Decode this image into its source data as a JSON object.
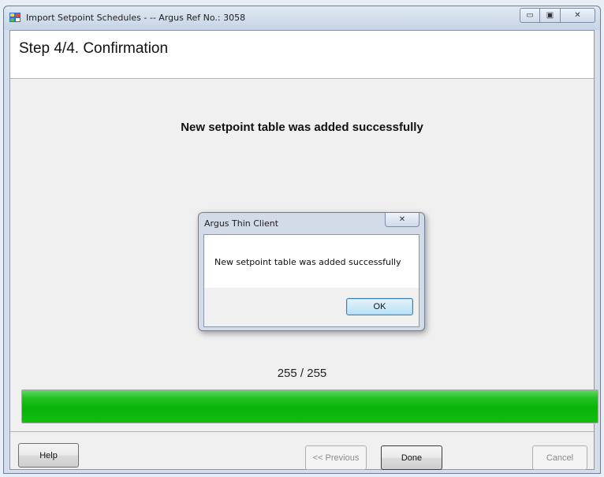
{
  "window": {
    "title": "Import Setpoint Schedules - -- Argus Ref No.: 3058",
    "minimize_glyph": "▭",
    "maximize_glyph": "▣",
    "close_glyph": "✕"
  },
  "step": {
    "title": "Step 4/4. Confirmation"
  },
  "main": {
    "message": "New setpoint table was added successfully"
  },
  "dialog": {
    "title": "Argus Thin Client",
    "close_glyph": "✕",
    "message": "New setpoint table was added successfully",
    "ok_label": "OK"
  },
  "progress": {
    "counter_text": "255 / 255",
    "fraction": 1.0,
    "color": "#08b408"
  },
  "footer": {
    "help_label": "Help",
    "previous_label": "<< Previous",
    "done_label": "Done",
    "cancel_label": "Cancel"
  },
  "icons": [
    "app-icon",
    "minimize-icon",
    "maximize-icon",
    "close-icon"
  ]
}
